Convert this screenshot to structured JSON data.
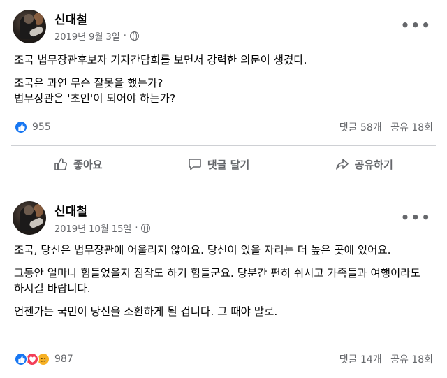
{
  "posts": [
    {
      "author": "신대철",
      "date": "2019년 9월 3일",
      "paragraphs": [
        "조국 법무장관후보자 기자간담회를 보면서 강력한 의문이 생겼다.",
        "조국은 과연 무슨 잘못을 했는가?\n법무장관은 '초인'이 되어야 하는가?"
      ],
      "reaction_count": "955",
      "comments": "댓글 58개",
      "shares": "공유 18회",
      "actions": {
        "like": "좋아요",
        "comment": "댓글 달기",
        "share": "공유하기"
      }
    },
    {
      "author": "신대철",
      "date": "2019년 10월 15일",
      "paragraphs": [
        "조국, 당신은 법무장관에 어울리지 않아요. 당신이 있을 자리는 더 높은 곳에  있어요.",
        "그동안 얼마나 힘들었을지 짐작도 하기 힘들군요. 당분간 편히 쉬시고 가족들과 여행이라도 하시길 바랍니다.",
        "언젠가는 국민이 당신을 소환하게 될 겁니다. 그 때야 말로."
      ],
      "reaction_count": "987",
      "comments": "댓글 14개",
      "shares": "공유 18회"
    }
  ],
  "colors": {
    "like_blue": "#1877f2",
    "love_red": "#f33e58",
    "sad_yellow": "#f7b125",
    "secondary_text": "#65676b"
  },
  "icons": {
    "privacy": "globe-icon",
    "menu": "more-options-icon"
  }
}
